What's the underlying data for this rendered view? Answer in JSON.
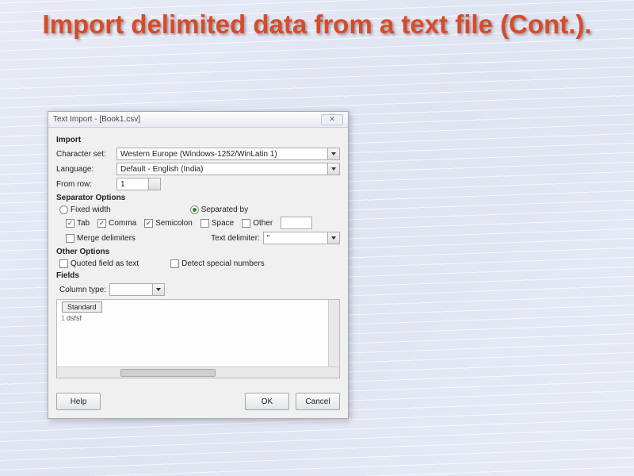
{
  "slide": {
    "title": "Import delimited data from a text file (Cont.)."
  },
  "dialog": {
    "title": "Text Import - [Book1.csv]",
    "import": {
      "heading": "Import",
      "charset_label": "Character set:",
      "charset_value": "Western Europe (Windows-1252/WinLatin 1)",
      "language_label": "Language:",
      "language_value": "Default - English (India)",
      "from_row_label": "From row:",
      "from_row_value": "1"
    },
    "separator": {
      "heading": "Separator Options",
      "fixed_width": "Fixed width",
      "separated_by": "Separated by",
      "tab": "Tab",
      "comma": "Comma",
      "semicolon": "Semicolon",
      "space": "Space",
      "other": "Other",
      "merge": "Merge delimiters",
      "text_delim_label": "Text delimiter:",
      "text_delim_value": "\""
    },
    "other": {
      "heading": "Other Options",
      "quoted": "Quoted field as text",
      "detect": "Detect special numbers"
    },
    "fields": {
      "heading": "Fields",
      "column_type_label": "Column type:",
      "column_type_value": "",
      "col_header": "Standard",
      "row1_num": "1",
      "row1_val": "dsfsf"
    },
    "buttons": {
      "help": "Help",
      "ok": "OK",
      "cancel": "Cancel"
    }
  }
}
